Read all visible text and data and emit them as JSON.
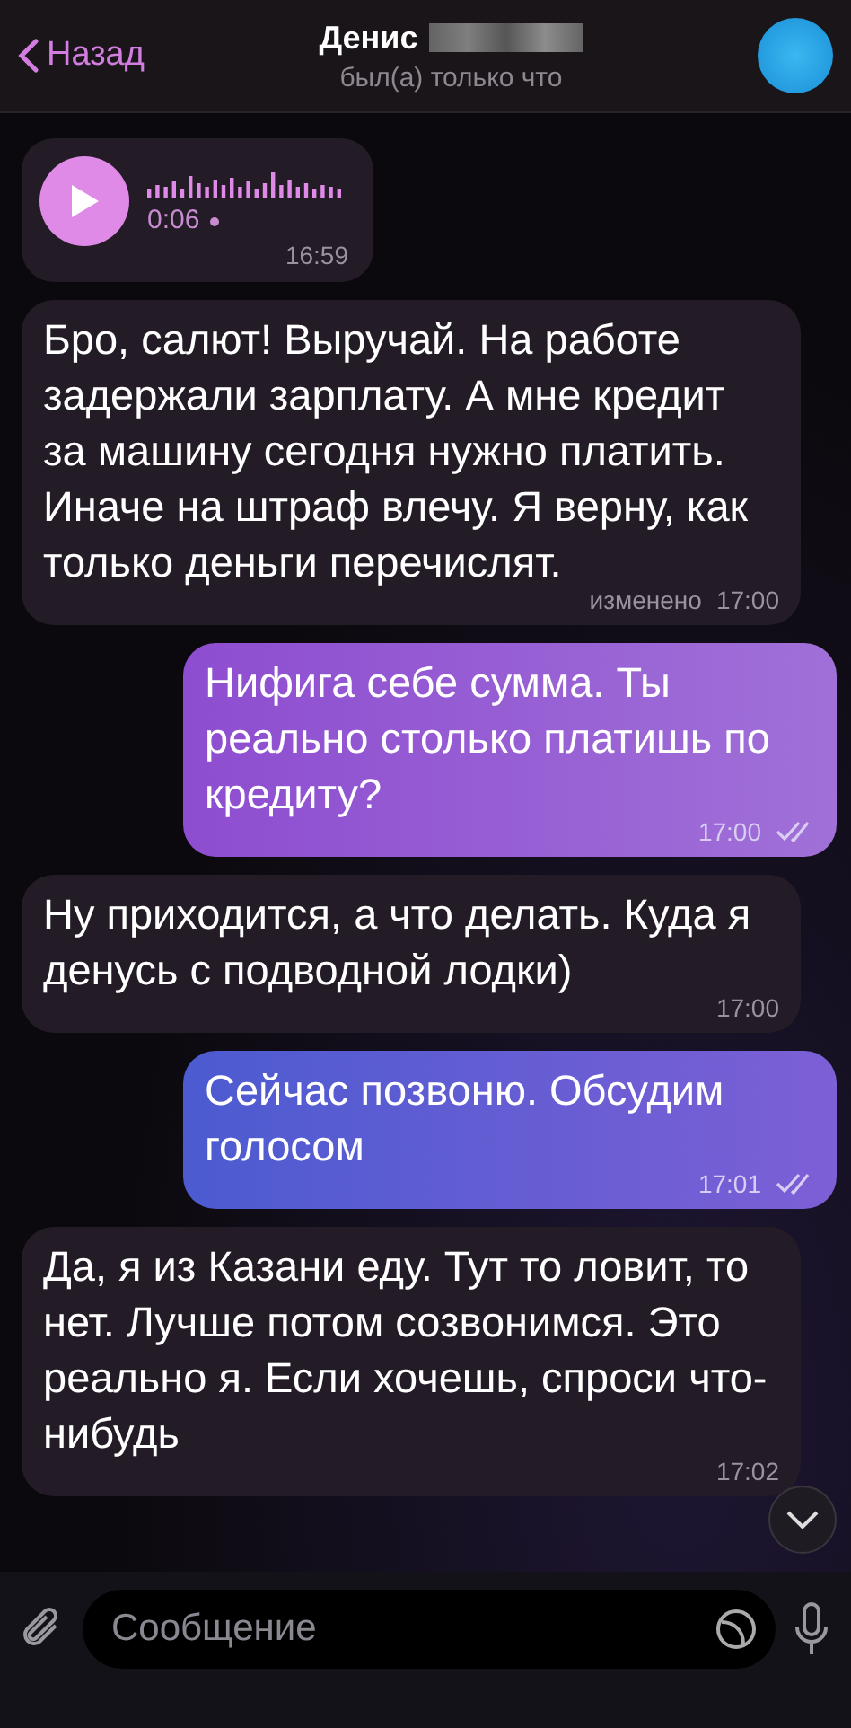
{
  "header": {
    "back": "Назад",
    "name": "Денис",
    "status": "был(а) только что"
  },
  "messages": [
    {
      "kind": "voice",
      "outgoing": false,
      "duration": "0:06",
      "time": "16:59"
    },
    {
      "kind": "text",
      "outgoing": false,
      "text": "Бро, салют! Выручай. На работе задержали зарплату. А мне кредит за машину сегодня нужно платить. Иначе на штраф влечу. Я верну, как только деньги перечислят.",
      "edited": "изменено",
      "time": "17:00"
    },
    {
      "kind": "text",
      "outgoing": true,
      "text": "Нифига себе сумма. Ты реально столько платишь по кредиту?",
      "time": "17:00",
      "read": true
    },
    {
      "kind": "text",
      "outgoing": false,
      "text": "Ну приходится, а что делать. Куда я денусь с подводной лодки)",
      "time": "17:00"
    },
    {
      "kind": "text",
      "outgoing": true,
      "text": "Сейчас позвоню. Обсудим голосом",
      "time": "17:01",
      "read": true
    },
    {
      "kind": "text",
      "outgoing": false,
      "text": "Да, я из Казани еду. Тут то ловит, то нет. Лучше потом созвонимся. Это реально я. Если хочешь, спроси что-нибудь",
      "time": "17:02"
    }
  ],
  "composer": {
    "placeholder": "Сообщение"
  }
}
